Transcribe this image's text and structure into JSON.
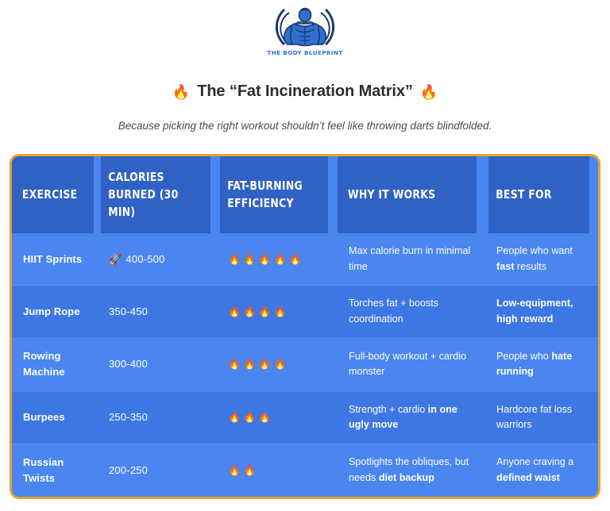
{
  "logo": {
    "brand_text": "The Body Blueprint",
    "icon": "bodybuilder-silhouette-logo",
    "primary_color": "#2f6fd0",
    "dark_color": "#1b3a6b"
  },
  "headline": {
    "left_icon": "🔥",
    "text": "The “Fat Incineration Matrix”",
    "right_icon": "🔥"
  },
  "subhead": {
    "text": "Because picking the right workout shouldn’t feel like throwing darts blindfolded."
  },
  "table": {
    "border_color": "#e8a22e",
    "header_bg": "#2f62c4",
    "row_bg_odd": "#4a85f0",
    "row_bg_even": "#3d77e3",
    "columns": [
      {
        "key": "exercise",
        "label": "EXERCISE"
      },
      {
        "key": "calories",
        "label": "CALORIES BURNED (30 MIN)"
      },
      {
        "key": "efficiency",
        "label": "FAT-BURNING EFFICIENCY"
      },
      {
        "key": "why",
        "label": "WHY IT WORKS"
      },
      {
        "key": "best",
        "label": "BEST FOR"
      }
    ],
    "rows": [
      {
        "exercise": "HIIT Sprints",
        "calories_icon": "🚀",
        "calories": "400-500",
        "efficiency_flames": 5,
        "efficiency": "🔥🔥🔥🔥🔥",
        "why_plain_1": "Max calorie burn in minimal time",
        "why_bold": "",
        "why_plain_2": "",
        "best_plain_1": "People who want ",
        "best_bold": "fast",
        "best_plain_2": " results"
      },
      {
        "exercise": "Jump Rope",
        "calories_icon": "",
        "calories": "350-450",
        "efficiency_flames": 4,
        "efficiency": "🔥🔥🔥🔥",
        "why_plain_1": "Torches fat + boosts coordination",
        "why_bold": "",
        "why_plain_2": "",
        "best_plain_1": "",
        "best_bold": "Low-equipment, high reward",
        "best_plain_2": ""
      },
      {
        "exercise": "Rowing Machine",
        "calories_icon": "",
        "calories": "300-400",
        "efficiency_flames": 4,
        "efficiency": "🔥🔥🔥🔥",
        "why_plain_1": "Full-body workout + cardio monster",
        "why_bold": "",
        "why_plain_2": "",
        "best_plain_1": "People who ",
        "best_bold": "hate running",
        "best_plain_2": ""
      },
      {
        "exercise": "Burpees",
        "calories_icon": "",
        "calories": "250-350",
        "efficiency_flames": 3,
        "efficiency": "🔥🔥🔥",
        "why_plain_1": "Strength + cardio ",
        "why_bold": "in one ugly move",
        "why_plain_2": "",
        "best_plain_1": "Hardcore fat loss warriors",
        "best_bold": "",
        "best_plain_2": ""
      },
      {
        "exercise": "Russian Twists",
        "calories_icon": "",
        "calories": "200-250",
        "efficiency_flames": 2,
        "efficiency": "🔥🔥",
        "why_plain_1": "Spotlights the obliques, but needs ",
        "why_bold": "diet backup",
        "why_plain_2": "",
        "best_plain_1": "Anyone craving a ",
        "best_bold": "defined waist",
        "best_plain_2": ""
      }
    ]
  }
}
